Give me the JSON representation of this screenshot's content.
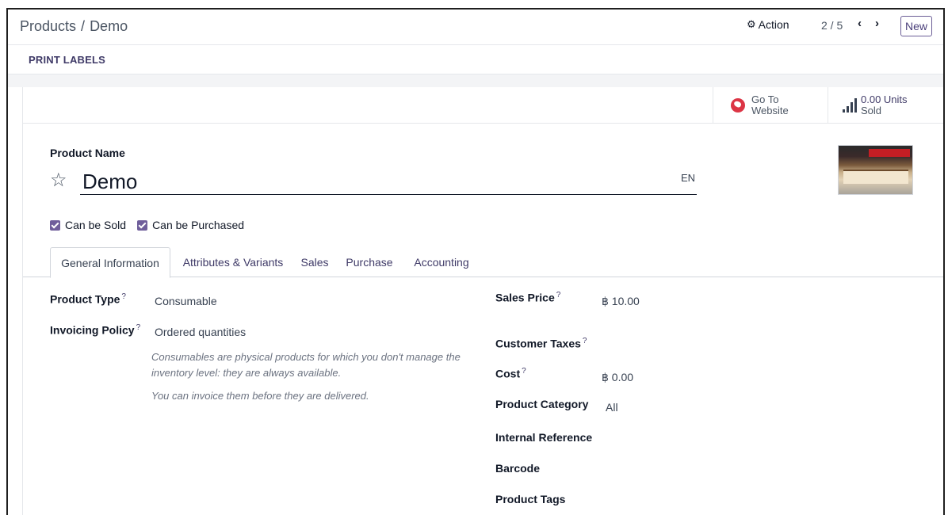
{
  "breadcrumb": {
    "parent": "Products",
    "separator": "/",
    "current": "Demo"
  },
  "control_panel": {
    "action_label": "Action",
    "action_icon": "gear-icon",
    "pager_value": "2 / 5",
    "prev_icon": "‹",
    "next_icon": "›",
    "new_label": "New"
  },
  "status_bar": {
    "print_labels": "PRINT LABELS"
  },
  "smart_buttons": {
    "website_line1": "Go To",
    "website_line2": "Website",
    "sold_value": "0.00 Units",
    "sold_label": "Sold"
  },
  "form": {
    "product_name_label": "Product Name",
    "product_name": "Demo",
    "lang": "EN",
    "can_be_sold": {
      "label": "Can be Sold",
      "checked": true
    },
    "can_be_purchased": {
      "label": "Can be Purchased",
      "checked": true
    }
  },
  "tabs": [
    {
      "label": "General Information",
      "active": true
    },
    {
      "label": "Attributes & Variants",
      "active": false
    },
    {
      "label": "Sales",
      "active": false
    },
    {
      "label": "Purchase",
      "active": false
    },
    {
      "label": "Accounting",
      "active": false
    }
  ],
  "general": {
    "product_type_label": "Product Type",
    "product_type": "Consumable",
    "invoicing_policy_label": "Invoicing Policy",
    "invoicing_policy": "Ordered quantities",
    "help_consumable": "Consumables are physical products for which you don't manage the inventory level: they are always available.",
    "help_invoice": "You can invoice them before they are delivered.",
    "sales_price_label": "Sales Price",
    "sales_price": "฿ 10.00",
    "customer_taxes_label": "Customer Taxes",
    "cost_label": "Cost",
    "cost": "฿ 0.00",
    "product_category_label": "Product Category",
    "product_category": "All",
    "internal_reference_label": "Internal Reference",
    "barcode_label": "Barcode",
    "product_tags_label": "Product Tags",
    "tooltip_mark": "?"
  },
  "colors": {
    "brand": "#714b67",
    "accent_button": "#6f5e9b",
    "danger": "#dc3545"
  }
}
